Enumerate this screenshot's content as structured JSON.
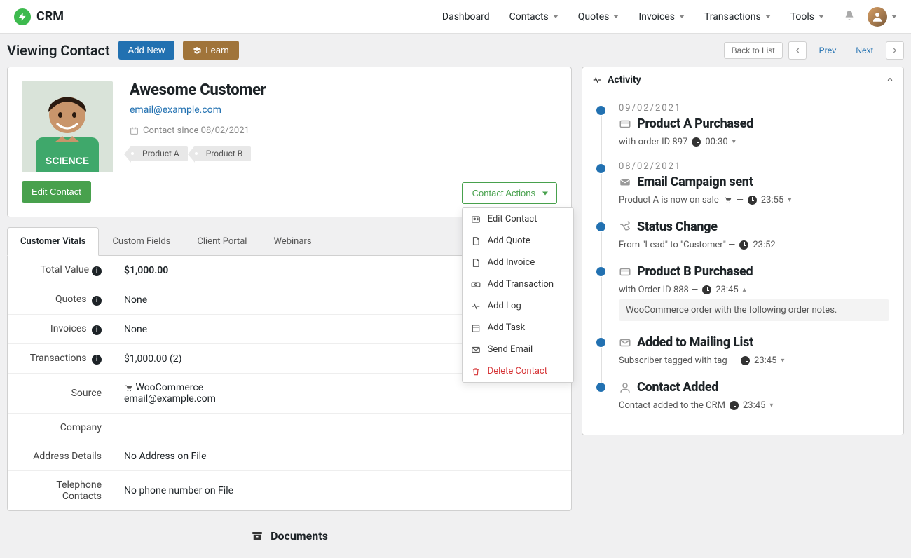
{
  "brand": "CRM",
  "nav": {
    "dashboard": "Dashboard",
    "contacts": "Contacts",
    "quotes": "Quotes",
    "invoices": "Invoices",
    "transactions": "Transactions",
    "tools": "Tools"
  },
  "subheader": {
    "title": "Viewing Contact",
    "add_new": "Add New",
    "learn": "Learn",
    "back_to_list": "Back to List",
    "prev": "Prev",
    "next": "Next"
  },
  "contact": {
    "name": "Awesome Customer",
    "email": "email@example.com",
    "since_label": "Contact since 08/02/2021",
    "tags": [
      "Product A",
      "Product B"
    ],
    "edit": "Edit Contact"
  },
  "actions_btn": "Contact Actions",
  "actions": {
    "edit": "Edit Contact",
    "quote": "Add Quote",
    "invoice": "Add Invoice",
    "transaction": "Add Transaction",
    "log": "Add Log",
    "task": "Add Task",
    "email": "Send Email",
    "delete": "Delete Contact"
  },
  "tabs": {
    "vitals": "Customer Vitals",
    "custom": "Custom Fields",
    "portal": "Client Portal",
    "webinars": "Webinars"
  },
  "vitals": {
    "total_value_label": "Total Value",
    "total_value": "$1,000.00",
    "quotes_label": "Quotes",
    "quotes": "None",
    "invoices_label": "Invoices",
    "invoices": "None",
    "transactions_label": "Transactions",
    "transactions": "$1,000.00 (2)",
    "source_label": "Source",
    "source": "WooCommerce",
    "source_email": "email@example.com",
    "company_label": "Company",
    "company": "",
    "address_label": "Address Details",
    "address": "No Address on File",
    "phone_label": "Telephone Contacts",
    "phone": "No phone number on File"
  },
  "documents_title": "Documents",
  "activity": {
    "title": "Activity",
    "items": [
      {
        "date": "09/02/2021",
        "title": "Product A Purchased",
        "icon": "card",
        "desc_prefix": "with order ID 897",
        "time": "00:30"
      },
      {
        "date": "08/02/2021",
        "title": "Email Campaign sent",
        "icon": "envelope",
        "desc_prefix": "Product A is now on sale",
        "desc_mid": "—",
        "time": "23:55",
        "cart": true
      },
      {
        "title": "Status Change",
        "icon": "shuffle",
        "desc_prefix": "From \"Lead\" to \"Customer\" —",
        "time": "23:52"
      },
      {
        "title": "Product B Purchased",
        "icon": "card",
        "desc_prefix": "with Order ID 888 —",
        "time": "23:45",
        "note": "WooCommerce order with the following order notes."
      },
      {
        "title": "Added to Mailing List",
        "icon": "envelope-o",
        "desc_prefix": "Subscriber tagged with tag —",
        "time": "23:45"
      },
      {
        "title": "Contact Added",
        "icon": "user",
        "desc_prefix": "Contact added to the CRM",
        "time": "23:45"
      }
    ]
  }
}
